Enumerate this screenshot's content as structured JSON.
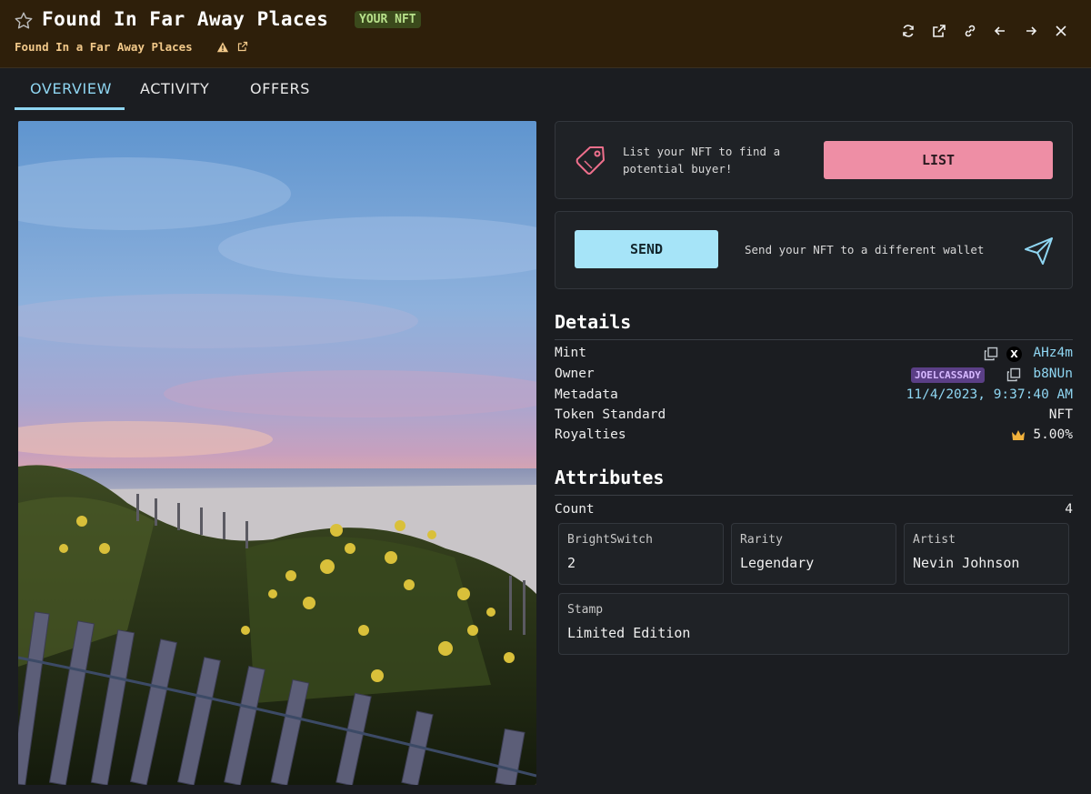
{
  "header": {
    "title": "Found In Far Away Places",
    "badge": "YOUR NFT",
    "subtitle": "Found In a Far Away Places"
  },
  "tabs": [
    {
      "label": "OVERVIEW",
      "active": true
    },
    {
      "label": "ACTIVITY",
      "active": false
    },
    {
      "label": "OFFERS",
      "active": false
    }
  ],
  "list_card": {
    "text": "List your NFT to find a potential buyer!",
    "button": "LIST"
  },
  "send_card": {
    "button": "SEND",
    "text": "Send your NFT to a different wallet"
  },
  "details": {
    "title": "Details",
    "rows": [
      {
        "label": "Mint",
        "value": "AHz4m",
        "badge": "X"
      },
      {
        "label": "Owner",
        "value": "b8NUn",
        "badge": "JOELCASSADY"
      },
      {
        "label": "Metadata",
        "value": "11/4/2023, 9:37:40 AM"
      },
      {
        "label": "Token Standard",
        "value": "NFT"
      },
      {
        "label": "Royalties",
        "value": "5.00%"
      }
    ]
  },
  "attributes": {
    "title": "Attributes",
    "count_label": "Count",
    "count": "4",
    "items": [
      {
        "key": "BrightSwitch",
        "value": "2"
      },
      {
        "key": "Rarity",
        "value": "Legendary"
      },
      {
        "key": "Artist",
        "value": "Nevin Johnson"
      },
      {
        "key": "Stamp",
        "value": "Limited Edition"
      }
    ]
  },
  "colors": {
    "header_bg": "#2e1f0a",
    "accent_blue": "#8fd6f2",
    "list_button": "#ee8ea5",
    "send_button": "#a6e4f8"
  }
}
